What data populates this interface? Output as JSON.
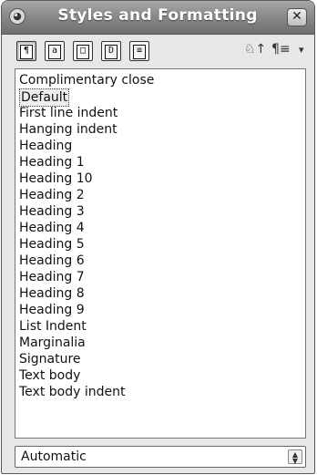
{
  "window": {
    "title": "Styles and Formatting"
  },
  "toolbar": {
    "buttons": [
      {
        "icon": "paragraph-styles-icon",
        "glyph": "¶"
      },
      {
        "icon": "character-styles-icon",
        "glyph": "a"
      },
      {
        "icon": "frame-styles-icon",
        "glyph": "□"
      },
      {
        "icon": "page-styles-icon",
        "glyph": "D"
      },
      {
        "icon": "list-styles-icon",
        "glyph": "≡"
      }
    ],
    "fill_format_glyph": "♘↑",
    "new_style_glyph": "¶≡",
    "menu_glyph": "▾"
  },
  "styles": [
    "Complimentary close",
    "Default",
    "First line indent",
    "Hanging indent",
    "Heading",
    "Heading 1",
    "Heading 10",
    "Heading 2",
    "Heading 3",
    "Heading 4",
    "Heading 5",
    "Heading 6",
    "Heading 7",
    "Heading 8",
    "Heading 9",
    "List Indent",
    "Marginalia",
    "Signature",
    "Text body",
    "Text body indent"
  ],
  "selected_style": "Default",
  "filter": {
    "value": "Automatic"
  }
}
